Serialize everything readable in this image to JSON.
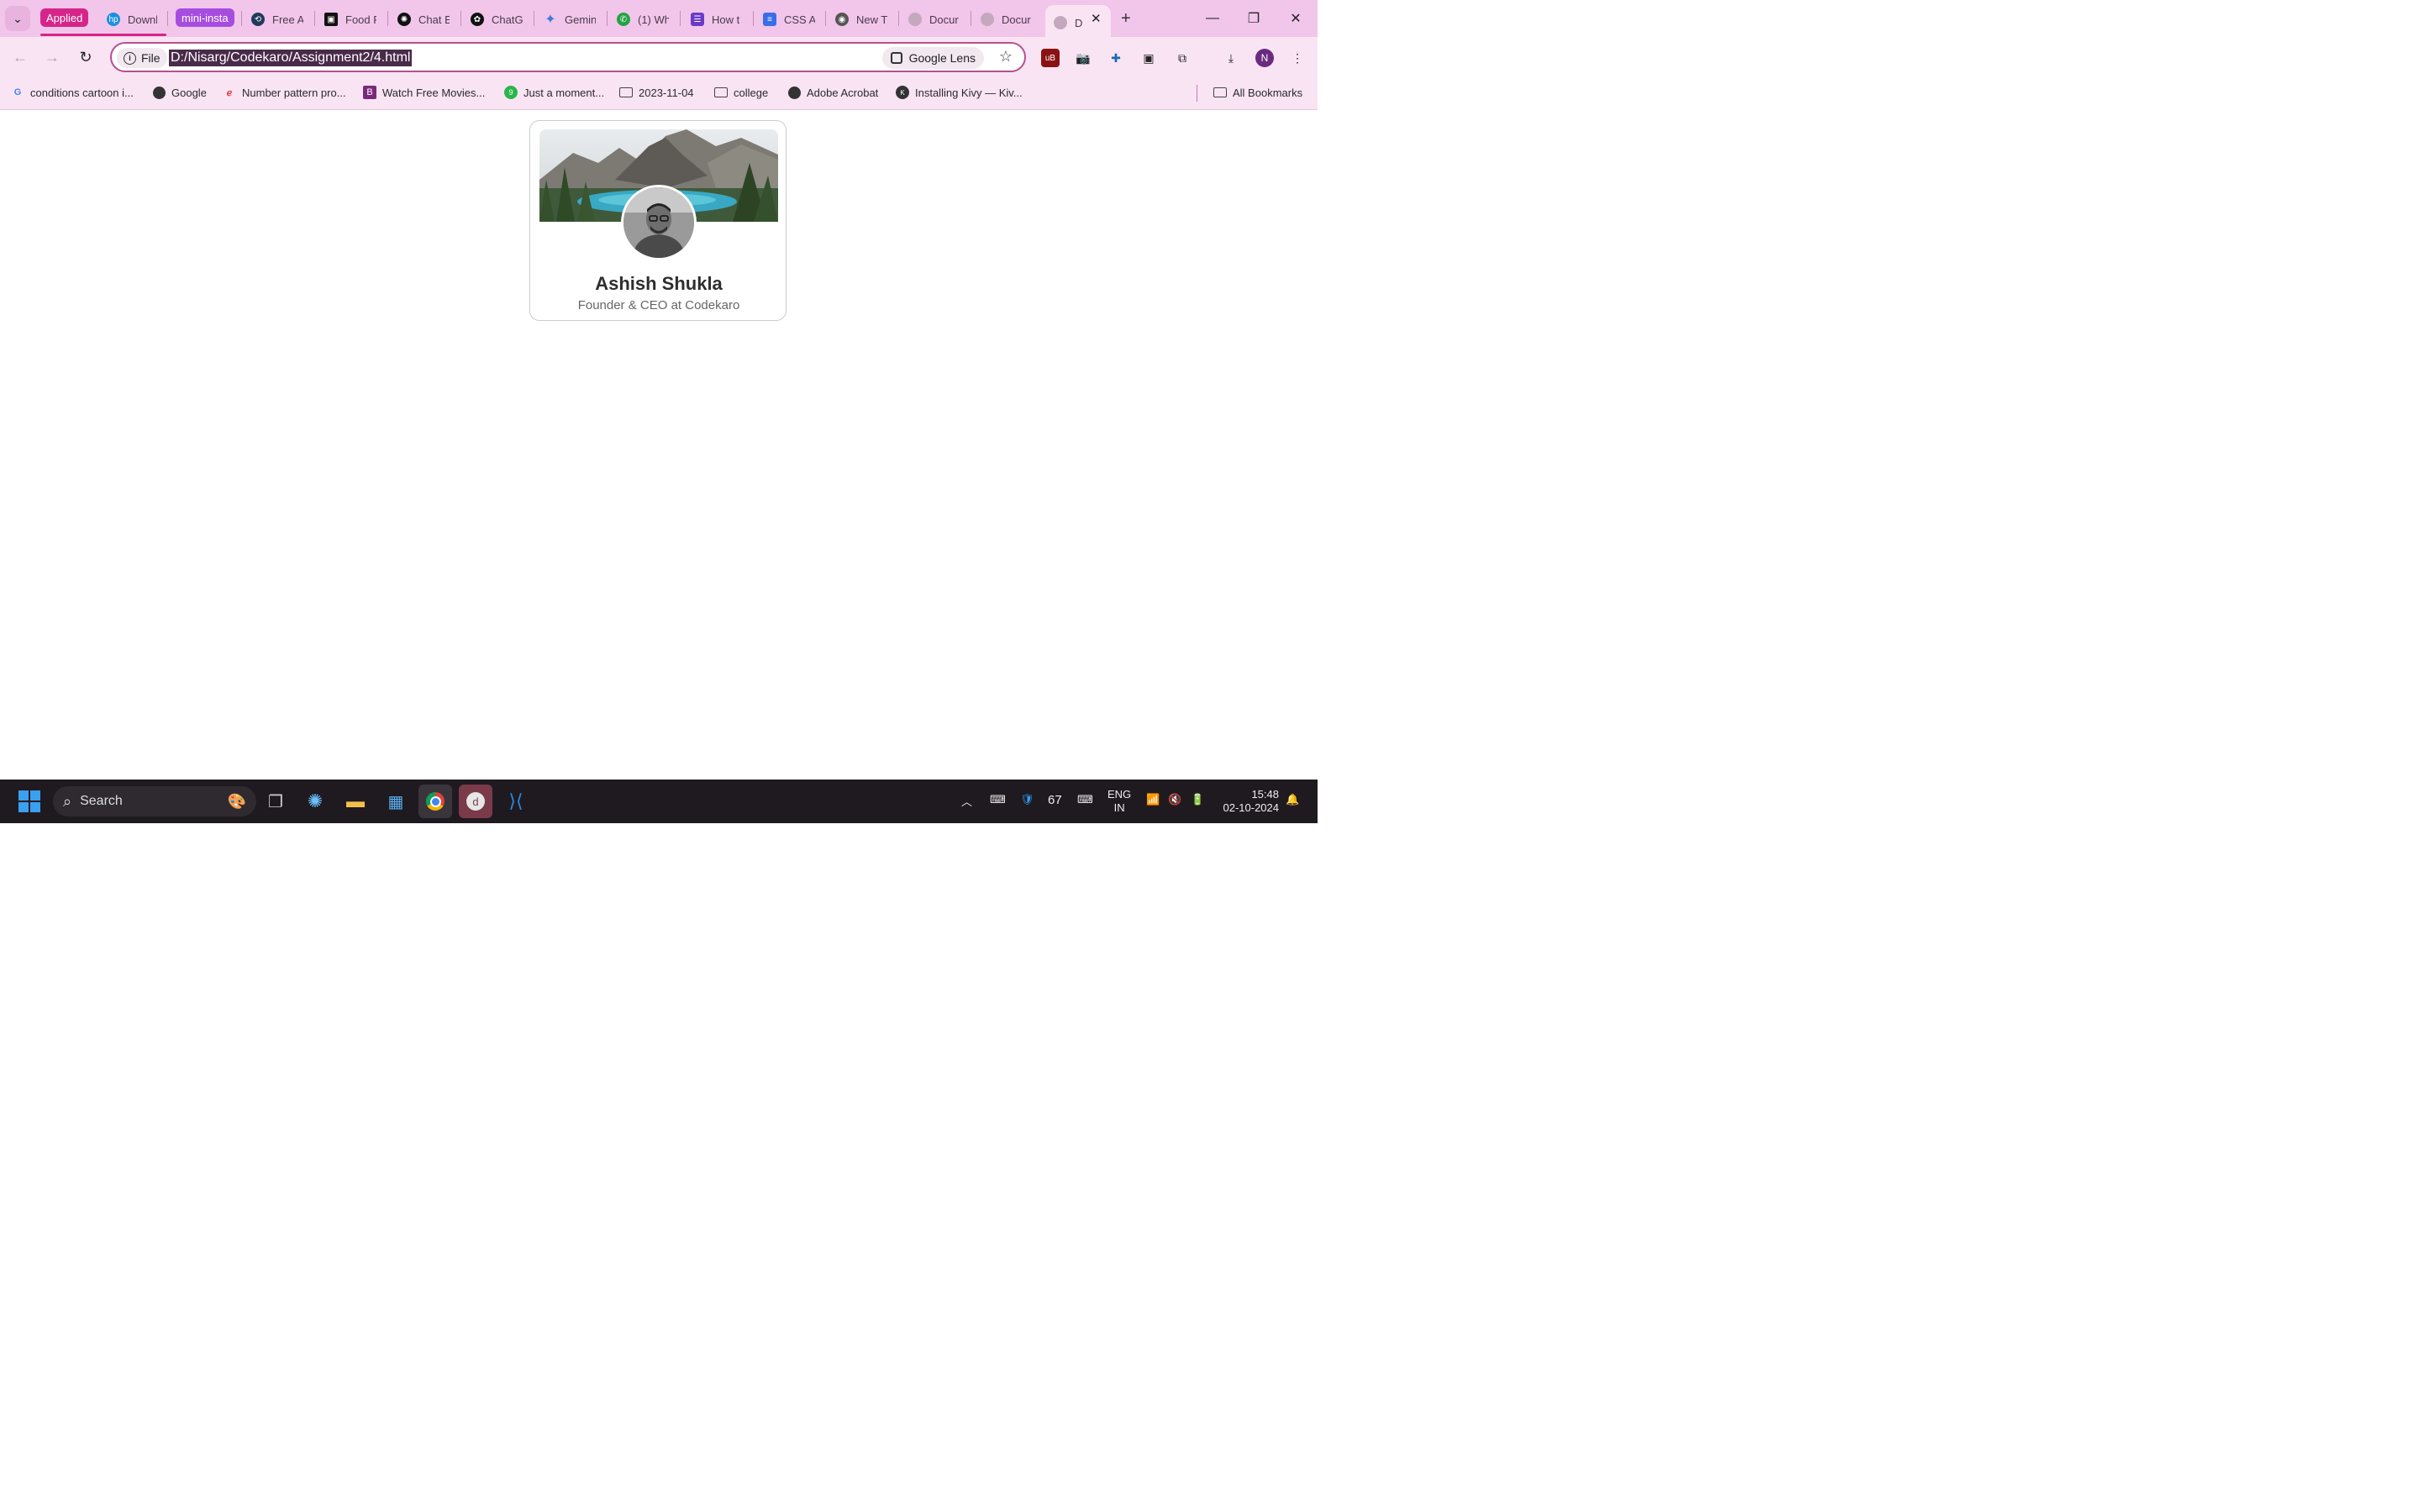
{
  "browser": {
    "tab_groups": [
      {
        "label": "Applied",
        "color": "#d6258a"
      },
      {
        "label": "mini-insta",
        "color": "#a64de0"
      }
    ],
    "tabs": [
      {
        "title": "Downl",
        "icon": "hp-icon",
        "color": "#1a8fe0"
      },
      {
        "title": "Free A",
        "icon": "refresh-logo-icon",
        "color": "#1f3a5a"
      },
      {
        "title": "Food F",
        "icon": "box-icon",
        "color": "#111"
      },
      {
        "title": "Chat E",
        "icon": "dot-logo-icon",
        "color": "#111"
      },
      {
        "title": "ChatG",
        "icon": "openai-icon",
        "color": "#111"
      },
      {
        "title": "Gemin",
        "icon": "sparkle-icon",
        "color": "#3b7be0"
      },
      {
        "title": "(1) Wh",
        "icon": "whatsapp-icon",
        "color": "#25a244"
      },
      {
        "title": "How t",
        "icon": "list-icon",
        "color": "#6a3ac9"
      },
      {
        "title": "CSS A",
        "icon": "docs-icon",
        "color": "#3a6ee8"
      },
      {
        "title": "New T",
        "icon": "chrome-icon",
        "color": "#555"
      },
      {
        "title": "Docur",
        "icon": "globe-icon",
        "color": "#aaa"
      },
      {
        "title": "Docur",
        "icon": "globe-icon",
        "color": "#aaa"
      }
    ],
    "active_tab": {
      "title": "D",
      "icon": "globe-icon"
    },
    "new_tab_label": "+",
    "address": {
      "scheme_chip": "File",
      "url": "D:/Nisarg/Codekaro/Assignment2/4.html",
      "lens_label": "Google Lens"
    },
    "profile_initial": "N",
    "bookmarks": [
      {
        "label": "conditions cartoon i...",
        "icon": "google-icon"
      },
      {
        "label": "Google",
        "icon": "globe-icon"
      },
      {
        "label": "Number pattern pro...",
        "icon": "e-logo-icon"
      },
      {
        "label": "Watch Free Movies...",
        "icon": "b-logo-icon"
      },
      {
        "label": "Just a moment...",
        "icon": "nine-logo-icon"
      },
      {
        "label": "2023-11-04",
        "icon": "folder-icon"
      },
      {
        "label": "college",
        "icon": "folder-icon"
      },
      {
        "label": "Adobe Acrobat",
        "icon": "globe-icon"
      },
      {
        "label": "Installing Kivy — Kiv...",
        "icon": "kivy-icon"
      }
    ],
    "all_bookmarks_label": "All Bookmarks"
  },
  "page": {
    "profile_name": "Ashish Shukla",
    "profile_role": "Founder & CEO at Codekaro"
  },
  "taskbar": {
    "search_label": "Search",
    "tray_temp": "67",
    "lang_top": "ENG",
    "lang_bottom": "IN",
    "time": "15:48",
    "date": "02-10-2024"
  }
}
